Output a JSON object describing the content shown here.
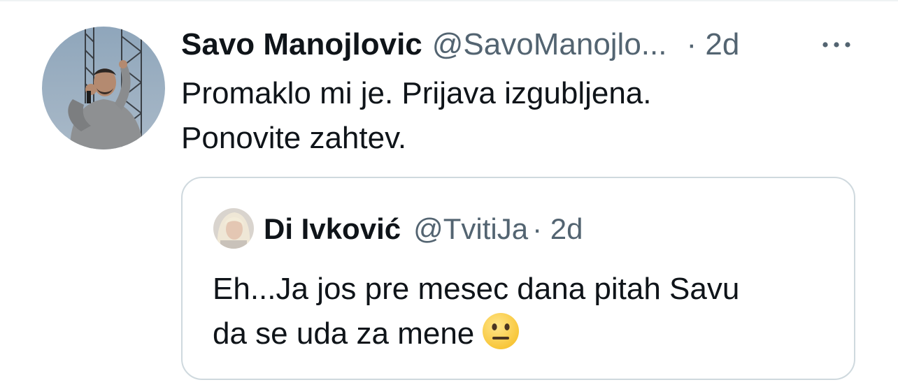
{
  "tweet": {
    "author_name": "Savo Manojlovic",
    "author_handle": "@SavoManojlo...",
    "timestamp": "· 2d",
    "text_line1": "Promaklo mi je. Prijava izgubljena.",
    "text_line2": "Ponovite zahtev.",
    "more_icon": "more-horizontal-icon"
  },
  "quoted_tweet": {
    "author_name": "Di Ivković",
    "author_handle": "@TvitiJa",
    "timestamp": "· 2d",
    "text_line1": "Eh...Ja jos pre mesec dana pitah Savu",
    "text_line2": "da se uda za mene",
    "emoji_icon": "neutral-face-emoji"
  },
  "colors": {
    "text_primary": "#0f1419",
    "text_secondary": "#536471",
    "border": "#cfd9de",
    "background": "#ffffff"
  }
}
